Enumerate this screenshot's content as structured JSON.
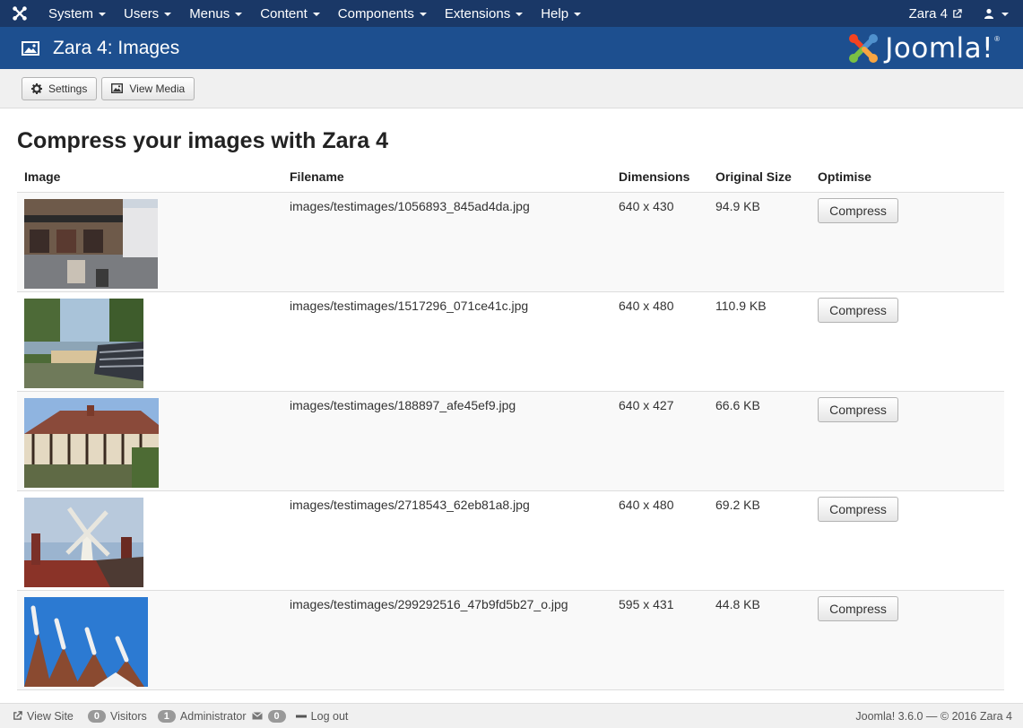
{
  "navbar": {
    "menu": [
      "System",
      "Users",
      "Menus",
      "Content",
      "Components",
      "Extensions",
      "Help"
    ],
    "site_name": "Zara 4",
    "icons": {
      "logo": "joomla-icon",
      "site_link": "external-link-icon",
      "user": "user-icon"
    }
  },
  "subhead": {
    "title": "Zara 4: Images",
    "brand": "Joomla!"
  },
  "toolbar": {
    "settings_label": "Settings",
    "view_media_label": "View Media"
  },
  "main": {
    "title": "Compress your images with Zara 4",
    "columns": [
      "Image",
      "Filename",
      "Dimensions",
      "Original Size",
      "Optimise"
    ],
    "compress_label": "Compress",
    "rows": [
      {
        "filename": "images/testimages/1056893_845ad4da.jpg",
        "dimensions": "640 x 430",
        "size": "94.9 KB"
      },
      {
        "filename": "images/testimages/1517296_071ce41c.jpg",
        "dimensions": "640 x 480",
        "size": "110.9 KB"
      },
      {
        "filename": "images/testimages/188897_afe45ef9.jpg",
        "dimensions": "640 x 427",
        "size": "66.6 KB"
      },
      {
        "filename": "images/testimages/2718543_62eb81a8.jpg",
        "dimensions": "640 x 480",
        "size": "69.2 KB"
      },
      {
        "filename": "images/testimages/299292516_47b9fd5b27_o.jpg",
        "dimensions": "595 x 431",
        "size": "44.8 KB"
      }
    ]
  },
  "footer": {
    "view_site": "View Site",
    "visitors_count": "0",
    "visitors_label": "Visitors",
    "admin_count": "1",
    "admin_label": "Administrator",
    "messages_count": "0",
    "logout": "Log out",
    "version": "Joomla! 3.6.0  —  © 2016 Zara 4"
  },
  "colors": {
    "navbar": "#1a3867",
    "subhead": "#1d4f8f"
  }
}
